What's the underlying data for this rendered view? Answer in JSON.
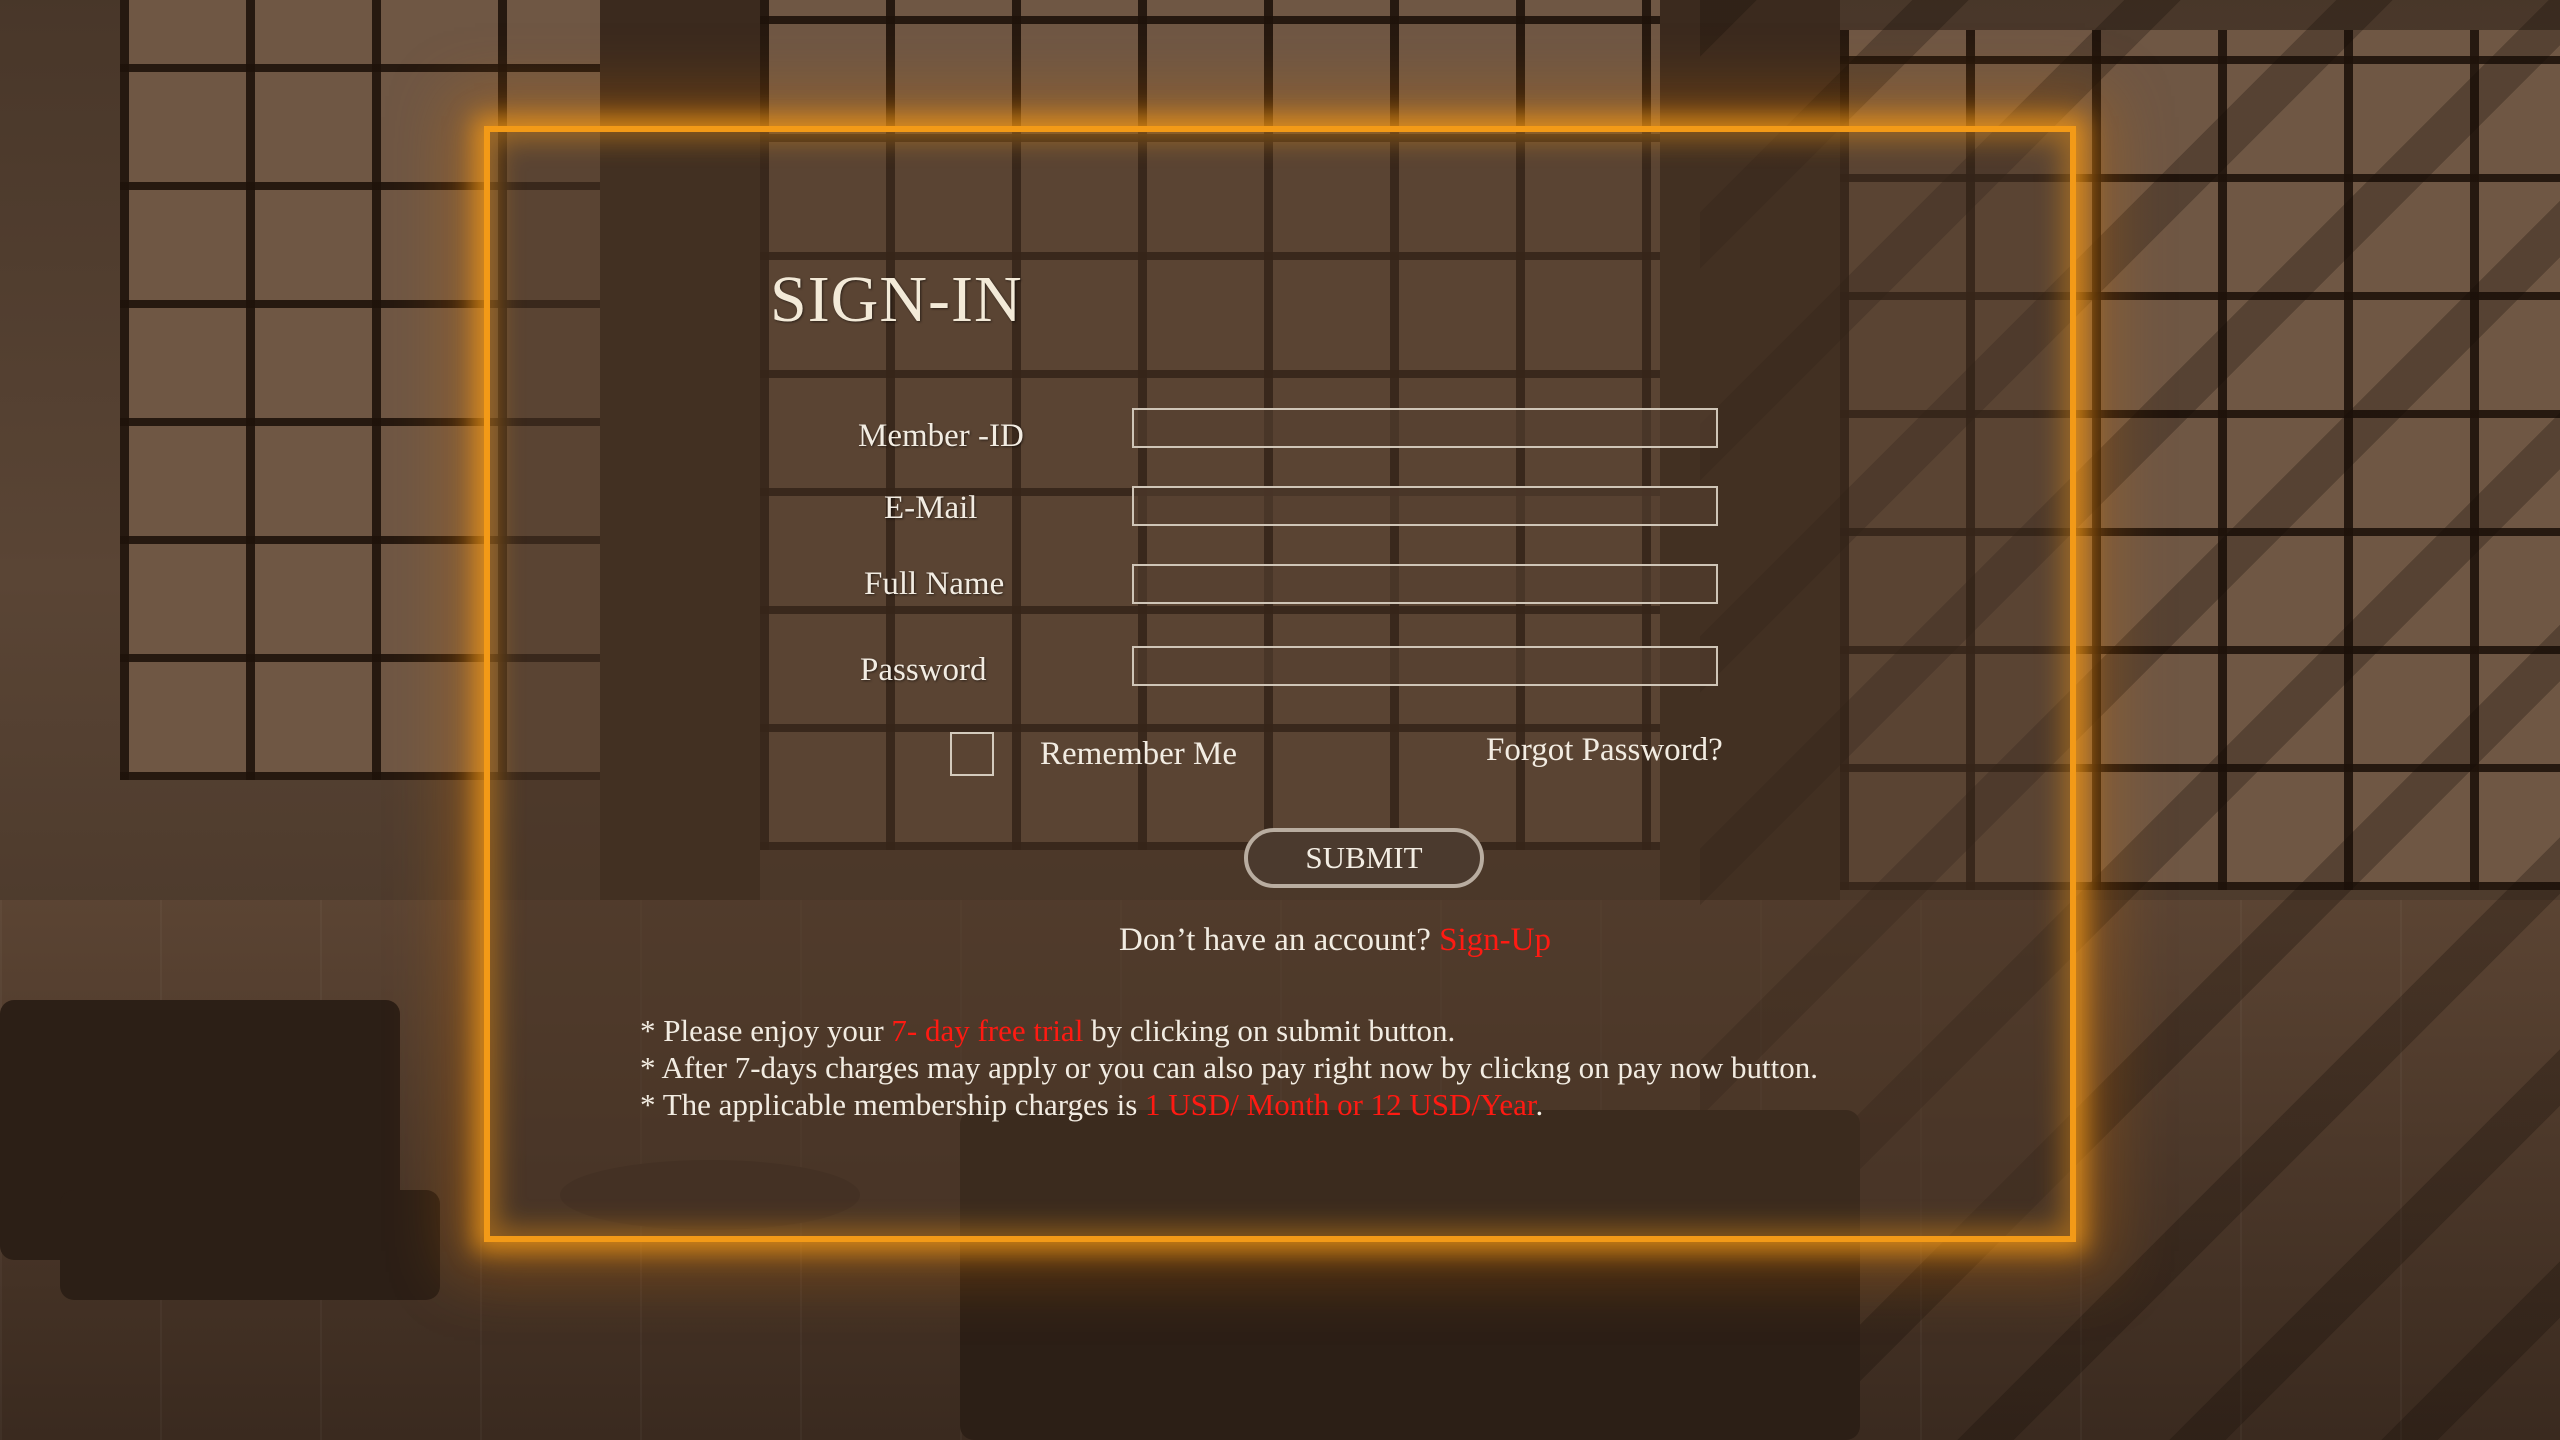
{
  "form": {
    "title": "SIGN-IN",
    "fields": [
      {
        "label": "Member -ID",
        "value": ""
      },
      {
        "label": "E-Mail",
        "value": ""
      },
      {
        "label": "Full Name",
        "value": ""
      },
      {
        "label": "Password",
        "value": ""
      }
    ],
    "remember_label": "Remember Me",
    "remember_checked": false,
    "forgot_label": "Forgot Password?",
    "submit_label": "SUBMIT",
    "signup_prompt": "Don’t have an account? ",
    "signup_label": "Sign-Up"
  },
  "notes": {
    "line1_pre": "* Please enjoy your ",
    "line1_highlight": "7- day free trial",
    "line1_post": " by clicking on submit button.",
    "line2": "* After 7-days charges may apply or you can also pay right now by clickng on pay now button.",
    "line3_pre": "* The applicable membership charges is  ",
    "line3_highlight": "1 USD/ Month or 12 USD/Year",
    "line3_post": "."
  },
  "colors": {
    "frame_glow": "#f39a17",
    "highlight": "#ff1a12",
    "text": "#f2ece2"
  }
}
